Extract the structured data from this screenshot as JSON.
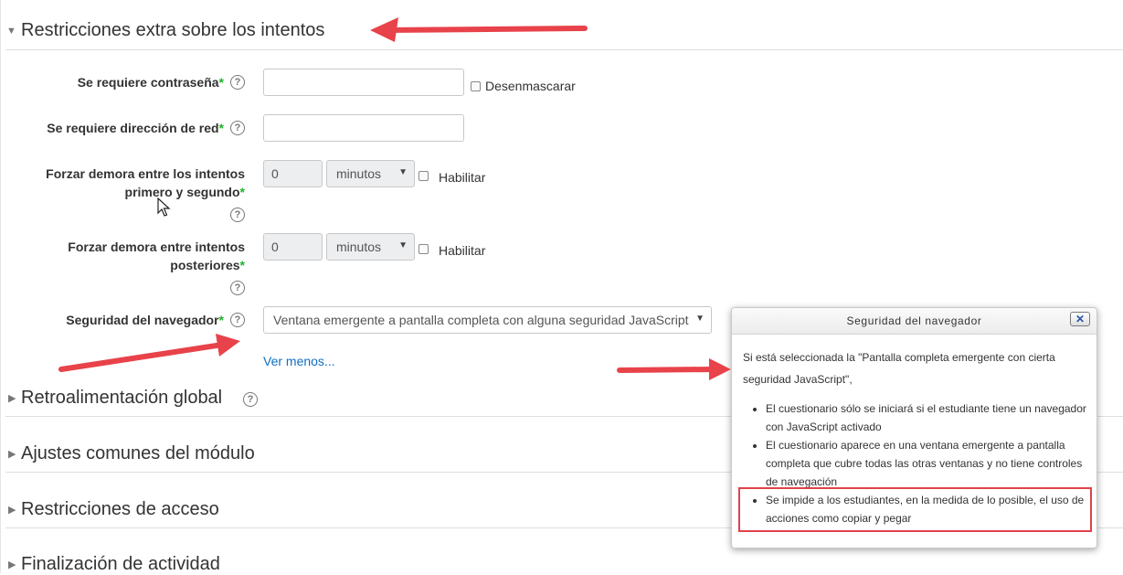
{
  "sections": {
    "s1": "Restricciones extra sobre los intentos",
    "s2": "Retroalimentación global",
    "s3": "Ajustes comunes del módulo",
    "s4": "Restricciones de acceso",
    "s5": "Finalización de actividad"
  },
  "form": {
    "password_label": "Se requiere contraseña",
    "unmask_label": "Desenmascarar",
    "network_label": "Se requiere dirección de red",
    "delay1_label_line1": "Forzar demora entre los intentos",
    "delay1_label_line2": "primero y segundo",
    "delay1_value": "0",
    "delay1_unit": "minutos",
    "delay1_enable": "Habilitar",
    "delay2_label_line1": "Forzar demora entre intentos",
    "delay2_label_line2": "posteriores",
    "delay2_value": "0",
    "delay2_unit": "minutos",
    "delay2_enable": "Habilitar",
    "browser_label": "Seguridad del navegador",
    "browser_value": "Ventana emergente a pantalla completa con alguna seguridad JavaScript",
    "show_less": "Ver menos...",
    "required_mark": "*"
  },
  "popup": {
    "title": "Seguridad del navegador",
    "close": "✕",
    "intro_line1": "Si está seleccionada la \"Pantalla completa emergente con cierta",
    "intro_line2": "seguridad JavaScript\",",
    "b1_l1": "El cuestionario sólo se iniciará si el estudiante tiene un navegador",
    "b1_l2": "con JavaScript activado",
    "b2_l1": "El cuestionario aparece en una ventana emergente a pantalla",
    "b2_l2": "completa que cubre todas las otras ventanas y no tiene controles",
    "b2_l3": "de navegación",
    "b3_l1": "Se impide a los estudiantes, en la medida de lo posible, el uso de",
    "b3_l2": "acciones como copiar y pegar"
  },
  "icons": {
    "help": "question-circle-icon",
    "expanded": "triangle-down-icon",
    "collapsed": "triangle-right-icon",
    "caret": "caret-down-icon"
  },
  "colors": {
    "required": "#1fb327",
    "link": "#0f6fc5",
    "annotation": "#e8424a"
  }
}
